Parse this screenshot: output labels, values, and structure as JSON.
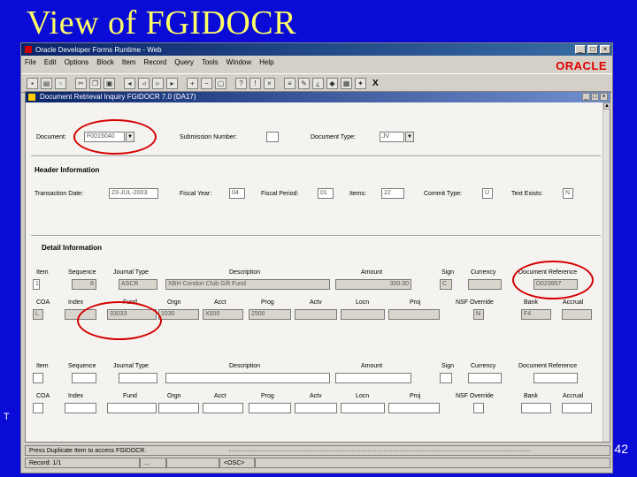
{
  "slide": {
    "title": "View of FGIDOCR",
    "page_number": "42",
    "left_mark": "T"
  },
  "window": {
    "title": "Oracle Developer Forms Runtime - Web",
    "min": "_",
    "max": "□",
    "close": "×"
  },
  "menu": [
    "File",
    "Edit",
    "Options",
    "Block",
    "Item",
    "Record",
    "Query",
    "Tools",
    "Window",
    "Help"
  ],
  "logo": "ORACLE",
  "inner": {
    "title": "Document Retrieval Inquiry  FGIDOCR  7.0  (DA17)"
  },
  "key": {
    "document_label": "Document:",
    "document_value": "F0015040",
    "submission_label": "Submission Number:",
    "submission_value": "",
    "doctype_label": "Document Type:",
    "doctype_value": "JV"
  },
  "header": {
    "section": "Header Information",
    "trans_date_label": "Transaction Date:",
    "trans_date_value": "23-JUL-2003",
    "fiscal_year_label": "Fiscal Year:",
    "fiscal_year_value": "04",
    "fiscal_period_label": "Fiscal Period:",
    "fiscal_period_value": "01",
    "items_label": "Items:",
    "items_value": "22",
    "commit_label": "Commit Type:",
    "commit_value": "U",
    "text_exists_label": "Text Exists:",
    "text_exists_value": "N"
  },
  "detail": {
    "section": "Detail Information",
    "col1": [
      "Item",
      "Sequence",
      "Journal Type",
      "Description",
      "Amount",
      "Sign",
      "Currency",
      "Document Reference"
    ],
    "col2": [
      "COA",
      "Index",
      "Fund",
      "Orgn",
      "Acct",
      "Prog",
      "Actv",
      "Locn",
      "Proj",
      "NSF Override",
      "Bank",
      "Accrual"
    ],
    "row1": {
      "item": "1",
      "sequence": "6",
      "journal_type": "ASCR",
      "description": "XBH Condon Club Gift Fund",
      "amount": "300.00",
      "sign": "C",
      "currency": "",
      "doc_ref": "D023957",
      "coa": "L",
      "index": "",
      "fund": "33033",
      "orgn": "1030",
      "acct": "X000",
      "prog": "2500",
      "actv": "",
      "locn": "",
      "proj": "",
      "nsf": "N",
      "bank": "F4",
      "accrual": ""
    }
  },
  "status": {
    "message": "Press Duplicate Item to access FGIDOCR.",
    "record": "Record: 1/1",
    "mid": "...",
    "osc": "<OSC>"
  }
}
